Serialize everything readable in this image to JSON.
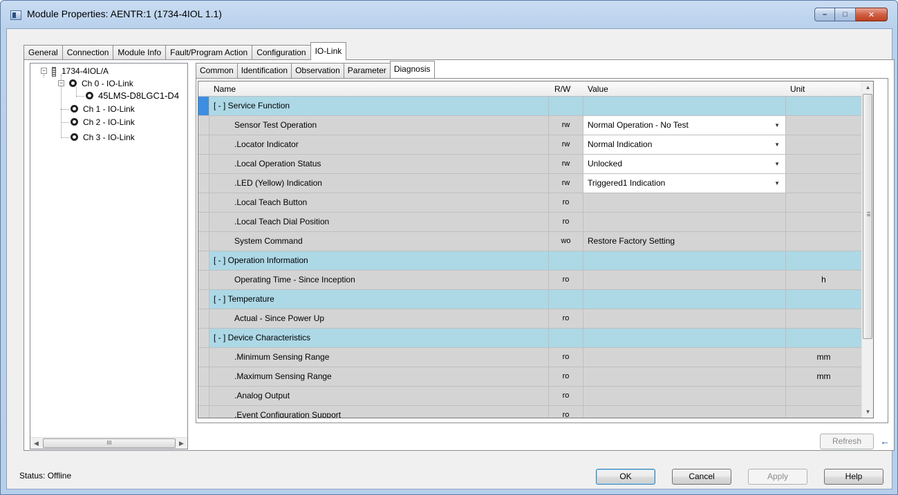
{
  "window": {
    "title": "Module Properties: AENTR:1 (1734-4IOL 1.1)",
    "minimize_glyph": "–",
    "maximize_glyph": "□",
    "close_glyph": "✕"
  },
  "outer_tabs": [
    "General",
    "Connection",
    "Module Info",
    "Fault/Program Action",
    "Configuration",
    "IO-Link"
  ],
  "outer_active": "IO-Link",
  "tree": {
    "root": "1734-4IOL/A",
    "channels": [
      "Ch 0 - IO-Link",
      "Ch 1 - IO-Link",
      "Ch 2 - IO-Link",
      "Ch 3 - IO-Link"
    ],
    "device": "45LMS-D8LGC1-D4",
    "scroll_thumb_glyph": "III",
    "scroll_left_glyph": "◀",
    "scroll_right_glyph": "▶"
  },
  "inner_tabs": [
    "Common",
    "Identification",
    "Observation",
    "Parameter",
    "Diagnosis"
  ],
  "inner_active": "Diagnosis",
  "grid": {
    "columns": {
      "name": "Name",
      "rw": "R/W",
      "value": "Value",
      "unit": "Unit"
    },
    "rows": [
      {
        "type": "cat",
        "name": "[ - ]  Service Function",
        "rw": "",
        "value": "",
        "unit": ""
      },
      {
        "type": "item",
        "name": "Sensor Test Operation",
        "rw": "rw",
        "value": "Normal Operation - No Test",
        "unit": "",
        "dropdown": true
      },
      {
        "type": "item",
        "name": ".Locator Indicator",
        "rw": "rw",
        "value": "Normal Indication",
        "unit": "",
        "dropdown": true
      },
      {
        "type": "item",
        "name": ".Local Operation Status",
        "rw": "rw",
        "value": "Unlocked",
        "unit": "",
        "dropdown": true
      },
      {
        "type": "item",
        "name": ".LED (Yellow) Indication",
        "rw": "rw",
        "value": "Triggered1 Indication",
        "unit": "",
        "dropdown": true
      },
      {
        "type": "item",
        "name": ".Local Teach Button",
        "rw": "ro",
        "value": "",
        "unit": ""
      },
      {
        "type": "item",
        "name": ".Local Teach Dial Position",
        "rw": "ro",
        "value": "",
        "unit": ""
      },
      {
        "type": "item",
        "name": "System Command",
        "rw": "wo",
        "value": "Restore Factory Setting",
        "unit": ""
      },
      {
        "type": "cat",
        "name": "[ - ]  Operation Information",
        "rw": "",
        "value": "",
        "unit": ""
      },
      {
        "type": "item",
        "name": "Operating Time - Since Inception",
        "rw": "ro",
        "value": "",
        "unit": "h"
      },
      {
        "type": "cat",
        "name": "[ - ]  Temperature",
        "rw": "",
        "value": "",
        "unit": ""
      },
      {
        "type": "item",
        "name": "Actual - Since Power Up",
        "rw": "ro",
        "value": "",
        "unit": ""
      },
      {
        "type": "cat",
        "name": "[ - ]  Device Characteristics",
        "rw": "",
        "value": "",
        "unit": ""
      },
      {
        "type": "item",
        "name": ".Minimum Sensing Range",
        "rw": "ro",
        "value": "",
        "unit": "mm"
      },
      {
        "type": "item",
        "name": ".Maximum Sensing Range",
        "rw": "ro",
        "value": "",
        "unit": "mm"
      },
      {
        "type": "item",
        "name": ".Analog Output",
        "rw": "ro",
        "value": "",
        "unit": ""
      },
      {
        "type": "item",
        "name": ".Event Configuration Support",
        "rw": "ro",
        "value": "",
        "unit": ""
      }
    ],
    "dropdown_glyph": "▼",
    "scroll_up_glyph": "▲",
    "scroll_down_glyph": "▼"
  },
  "buttons": {
    "refresh": "Refresh",
    "ok": "OK",
    "cancel": "Cancel",
    "apply": "Apply",
    "help": "Help",
    "refresh_arrow_glyph": "←"
  },
  "status": "Status:  Offline"
}
